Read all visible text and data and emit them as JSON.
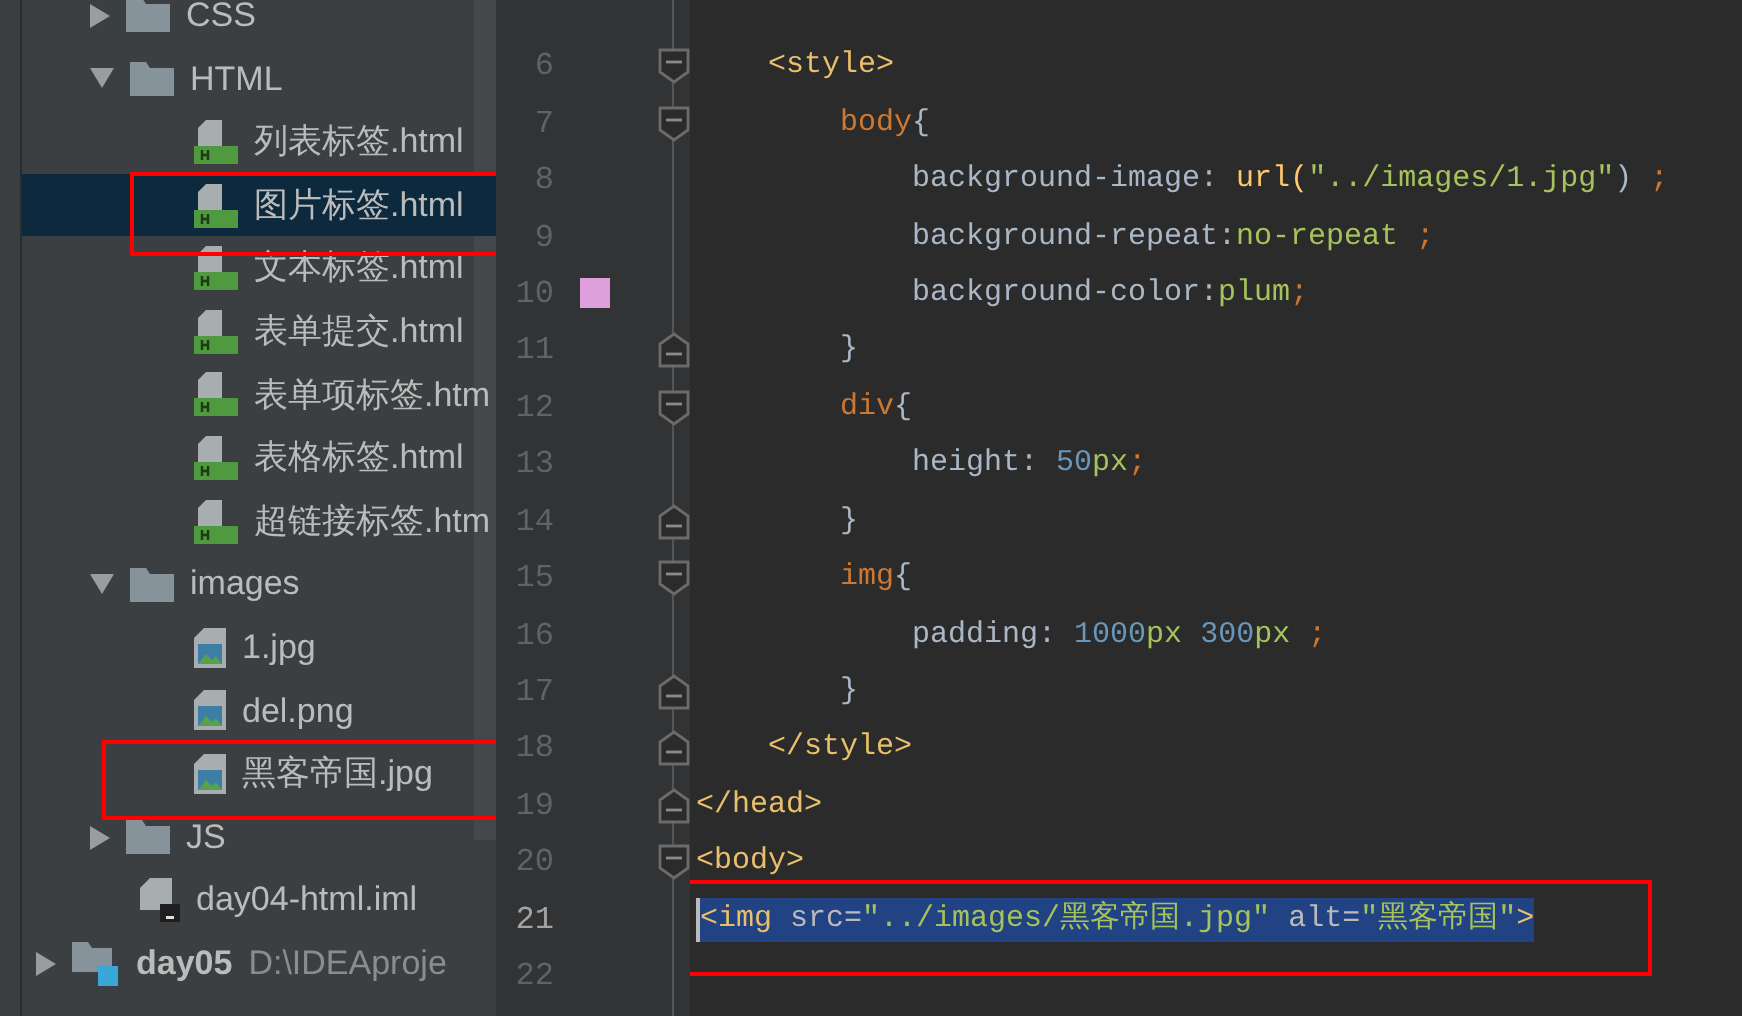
{
  "project_tree": {
    "items": [
      {
        "label": "CSS",
        "kind": "folder",
        "expanded": false,
        "selected": false,
        "annotated": false
      },
      {
        "label": "HTML",
        "kind": "folder",
        "expanded": true,
        "selected": false,
        "annotated": false,
        "children": [
          {
            "label": "列表标签.html",
            "kind": "html",
            "selected": false,
            "annotated": false
          },
          {
            "label": "图片标签.html",
            "kind": "html",
            "selected": true,
            "annotated": true
          },
          {
            "label": "文本标签.html",
            "kind": "html",
            "selected": false,
            "annotated": false
          },
          {
            "label": "表单提交.html",
            "kind": "html",
            "selected": false,
            "annotated": false
          },
          {
            "label": "表单项标签.htm",
            "kind": "html",
            "selected": false,
            "annotated": false
          },
          {
            "label": "表格标签.html",
            "kind": "html",
            "selected": false,
            "annotated": false
          },
          {
            "label": "超链接标签.htm",
            "kind": "html",
            "selected": false,
            "annotated": false
          }
        ]
      },
      {
        "label": "images",
        "kind": "folder",
        "expanded": true,
        "selected": false,
        "annotated": false,
        "children": [
          {
            "label": "1.jpg",
            "kind": "image",
            "selected": false,
            "annotated": false
          },
          {
            "label": "del.png",
            "kind": "image",
            "selected": false,
            "annotated": false
          },
          {
            "label": "黑客帝国.jpg",
            "kind": "image",
            "selected": false,
            "annotated": true
          }
        ]
      },
      {
        "label": "JS",
        "kind": "folder",
        "expanded": false,
        "selected": false,
        "annotated": false
      },
      {
        "label": "day04-html.iml",
        "kind": "iml",
        "selected": false,
        "annotated": false
      }
    ],
    "modules": [
      {
        "label": "day05",
        "path": "D:\\IDEAproje",
        "expanded": false
      }
    ]
  },
  "editor": {
    "lines": [
      {
        "number": "6",
        "fold": {
          "kind": "open"
        },
        "selected": false,
        "annotated": false,
        "tokens": [
          {
            "kind": "tag",
            "text": "    <style>"
          }
        ]
      },
      {
        "number": "7",
        "fold": {
          "kind": "open"
        },
        "selected": false,
        "annotated": false,
        "tokens": [
          {
            "kind": "selector",
            "text": "        body"
          },
          {
            "kind": "text",
            "text": "{"
          }
        ]
      },
      {
        "number": "8",
        "selected": false,
        "annotated": false,
        "tokens": [
          {
            "kind": "text",
            "text": "            background-image: "
          },
          {
            "kind": "func",
            "text": "url("
          },
          {
            "kind": "string",
            "text": "\"../images/1.jpg\""
          },
          {
            "kind": "text",
            "text": ")"
          },
          {
            "kind": "punct",
            "text": " ;"
          }
        ]
      },
      {
        "number": "9",
        "selected": false,
        "annotated": false,
        "tokens": [
          {
            "kind": "text",
            "text": "            background-repeat:"
          },
          {
            "kind": "value",
            "text": "no-repeat"
          },
          {
            "kind": "punct",
            "text": " ;"
          }
        ]
      },
      {
        "number": "10",
        "color": "#dda0dd",
        "selected": false,
        "annotated": false,
        "tokens": [
          {
            "kind": "text",
            "text": "            background-color:"
          },
          {
            "kind": "value",
            "text": "plum"
          },
          {
            "kind": "punct",
            "text": ";"
          }
        ]
      },
      {
        "number": "11",
        "fold": {
          "kind": "close"
        },
        "selected": false,
        "annotated": false,
        "tokens": [
          {
            "kind": "text",
            "text": "        }"
          }
        ]
      },
      {
        "number": "12",
        "fold": {
          "kind": "open"
        },
        "selected": false,
        "annotated": false,
        "tokens": [
          {
            "kind": "selector",
            "text": "        div"
          },
          {
            "kind": "text",
            "text": "{"
          }
        ]
      },
      {
        "number": "13",
        "selected": false,
        "annotated": false,
        "tokens": [
          {
            "kind": "text",
            "text": "            height: "
          },
          {
            "kind": "number",
            "text": "50"
          },
          {
            "kind": "value",
            "text": "px"
          },
          {
            "kind": "punct",
            "text": ";"
          }
        ]
      },
      {
        "number": "14",
        "fold": {
          "kind": "close"
        },
        "selected": false,
        "annotated": false,
        "tokens": [
          {
            "kind": "text",
            "text": "        }"
          }
        ]
      },
      {
        "number": "15",
        "fold": {
          "kind": "open"
        },
        "selected": false,
        "annotated": false,
        "tokens": [
          {
            "kind": "selector",
            "text": "        img"
          },
          {
            "kind": "text",
            "text": "{"
          }
        ]
      },
      {
        "number": "16",
        "selected": false,
        "annotated": false,
        "tokens": [
          {
            "kind": "text",
            "text": "            padding: "
          },
          {
            "kind": "number",
            "text": "1000"
          },
          {
            "kind": "value",
            "text": "px "
          },
          {
            "kind": "number",
            "text": "300"
          },
          {
            "kind": "value",
            "text": "px"
          },
          {
            "kind": "punct",
            "text": " ;"
          }
        ]
      },
      {
        "number": "17",
        "fold": {
          "kind": "close"
        },
        "selected": false,
        "annotated": false,
        "tokens": [
          {
            "kind": "text",
            "text": "        }"
          }
        ]
      },
      {
        "number": "18",
        "fold": {
          "kind": "close"
        },
        "selected": false,
        "annotated": false,
        "tokens": [
          {
            "kind": "tag",
            "text": "    </style>"
          }
        ]
      },
      {
        "number": "19",
        "fold": {
          "kind": "close"
        },
        "selected": false,
        "annotated": false,
        "tokens": [
          {
            "kind": "tag",
            "text": "</head>"
          }
        ]
      },
      {
        "number": "20",
        "fold": {
          "kind": "open"
        },
        "selected": false,
        "annotated": false,
        "tokens": [
          {
            "kind": "tag",
            "text": "<body>"
          }
        ]
      },
      {
        "number": "21",
        "selected": true,
        "annotated": true,
        "tokens": [
          {
            "kind": "tag",
            "text": "<img "
          },
          {
            "kind": "attr",
            "text": "src="
          },
          {
            "kind": "string",
            "text": "\"../images/黑客帝国.jpg\""
          },
          {
            "kind": "attr",
            "text": " alt="
          },
          {
            "kind": "string",
            "text": "\"黑客帝国\""
          },
          {
            "kind": "tag",
            "text": ">"
          }
        ]
      },
      {
        "number": "22"
      }
    ]
  }
}
